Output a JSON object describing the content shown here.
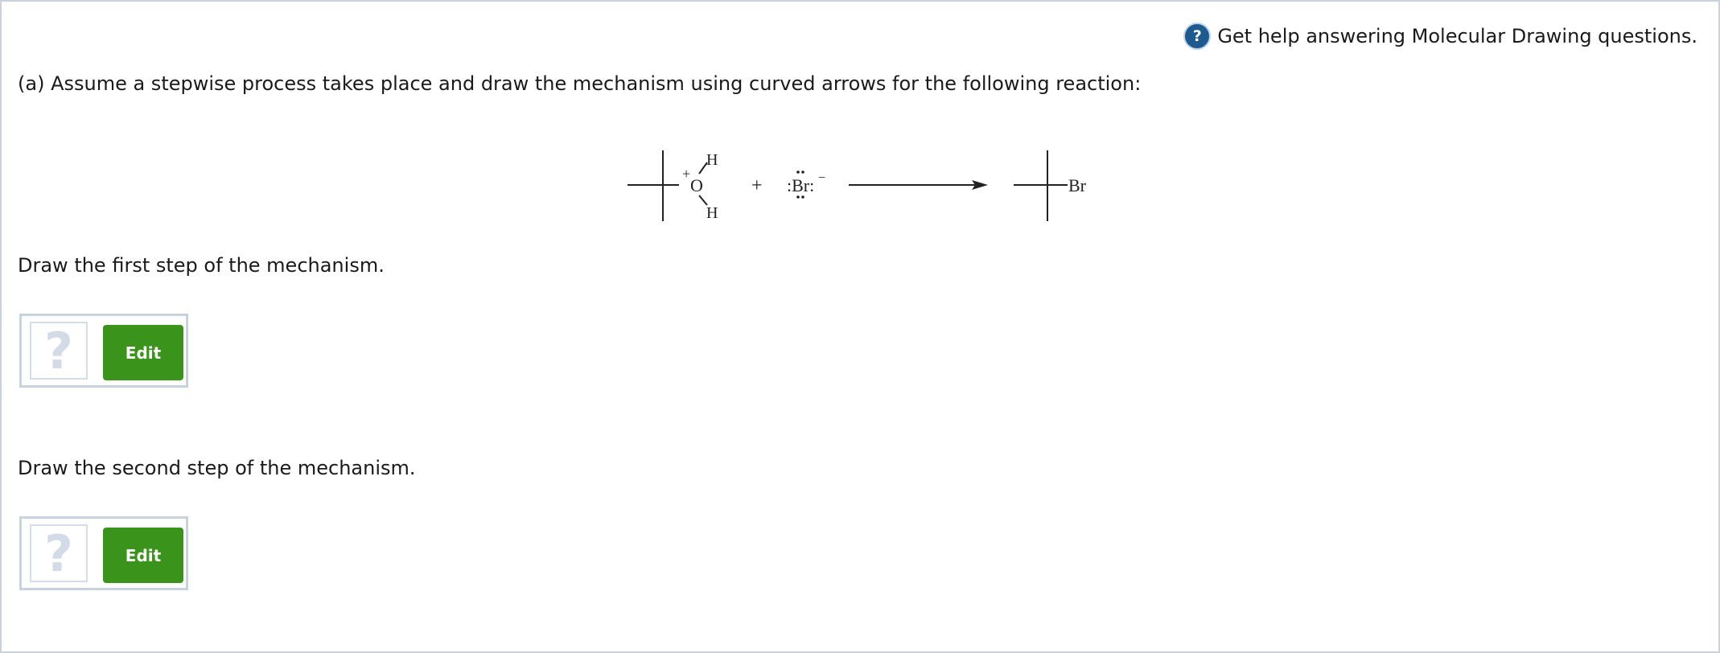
{
  "help": {
    "icon": "help-circle-icon",
    "text": "Get help answering Molecular Drawing questions."
  },
  "question": "(a) Assume a stepwise process takes place and draw the mechanism using curved arrows for the following reaction:",
  "reaction": {
    "reactant1": {
      "charge": "+",
      "oxygen": "O",
      "h_top": "H",
      "h_bottom": "H"
    },
    "plus": "+",
    "reactant2": {
      "text": ":Br:",
      "charge": "−"
    },
    "product": {
      "text": "Br"
    }
  },
  "steps": [
    {
      "label": "Draw the first step of the mechanism.",
      "placeholder": "?",
      "button": "Edit"
    },
    {
      "label": "Draw the second step of the mechanism.",
      "placeholder": "?",
      "button": "Edit"
    }
  ],
  "colors": {
    "edit_button": "#3a941c",
    "help_icon": "#1c5a8f",
    "frame_border": "#c9d3df"
  }
}
